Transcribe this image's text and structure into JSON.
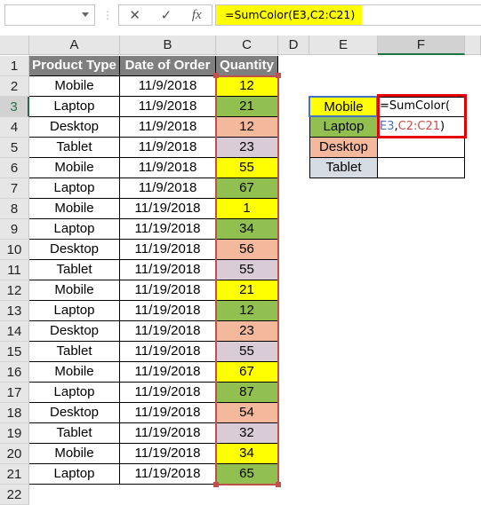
{
  "formula_bar": {
    "name_box": "",
    "formula": "=SumColor(E3,C2:C21)",
    "cancel_icon": "✕",
    "enter_icon": "✓",
    "fx_label": "fx"
  },
  "columns": [
    "A",
    "B",
    "C",
    "D",
    "E",
    "F"
  ],
  "rows": [
    "1",
    "2",
    "3",
    "4",
    "5",
    "6",
    "7",
    "8",
    "9",
    "10",
    "11",
    "12",
    "13",
    "14",
    "15",
    "16",
    "17",
    "18",
    "19",
    "20",
    "21",
    "22"
  ],
  "table": {
    "headers": [
      "Product Type",
      "Date of Order",
      "Quantity"
    ],
    "rows": [
      {
        "type": "Mobile",
        "date": "11/9/2018",
        "qty": "12",
        "color": "#ffff00"
      },
      {
        "type": "Laptop",
        "date": "11/9/2018",
        "qty": "21",
        "color": "#92c050"
      },
      {
        "type": "Desktop",
        "date": "11/9/2018",
        "qty": "12",
        "color": "#f4b89c"
      },
      {
        "type": "Tablet",
        "date": "11/9/2018",
        "qty": "23",
        "color": "#d9ccd7"
      },
      {
        "type": "Mobile",
        "date": "11/9/2018",
        "qty": "55",
        "color": "#ffff00"
      },
      {
        "type": "Laptop",
        "date": "11/9/2018",
        "qty": "67",
        "color": "#92c050"
      },
      {
        "type": "Mobile",
        "date": "11/19/2018",
        "qty": "1",
        "color": "#ffff00"
      },
      {
        "type": "Laptop",
        "date": "11/19/2018",
        "qty": "34",
        "color": "#92c050"
      },
      {
        "type": "Desktop",
        "date": "11/19/2018",
        "qty": "56",
        "color": "#f4b89c"
      },
      {
        "type": "Tablet",
        "date": "11/19/2018",
        "qty": "55",
        "color": "#d9ccd7"
      },
      {
        "type": "Mobile",
        "date": "11/19/2018",
        "qty": "21",
        "color": "#ffff00"
      },
      {
        "type": "Laptop",
        "date": "11/19/2018",
        "qty": "12",
        "color": "#92c050"
      },
      {
        "type": "Desktop",
        "date": "11/19/2018",
        "qty": "23",
        "color": "#f4b89c"
      },
      {
        "type": "Tablet",
        "date": "11/19/2018",
        "qty": "55",
        "color": "#d9ccd7"
      },
      {
        "type": "Mobile",
        "date": "11/19/2018",
        "qty": "67",
        "color": "#ffff00"
      },
      {
        "type": "Laptop",
        "date": "11/19/2018",
        "qty": "87",
        "color": "#92c050"
      },
      {
        "type": "Desktop",
        "date": "11/19/2018",
        "qty": "54",
        "color": "#f4b89c"
      },
      {
        "type": "Tablet",
        "date": "11/19/2018",
        "qty": "32",
        "color": "#d9ccd7"
      },
      {
        "type": "Mobile",
        "date": "11/19/2018",
        "qty": "34",
        "color": "#ffff00"
      },
      {
        "type": "Laptop",
        "date": "11/19/2018",
        "qty": "65",
        "color": "#92c050"
      }
    ]
  },
  "summary": {
    "labels": [
      {
        "text": "Mobile",
        "color": "#ffff00"
      },
      {
        "text": "Laptop",
        "color": "#92c050"
      },
      {
        "text": "Desktop",
        "color": "#f4b89c"
      },
      {
        "text": "Tablet",
        "color": "#d6dce4"
      }
    ],
    "formula_line1": "=SumColor(",
    "formula_arg1": "E3",
    "formula_sep": ",",
    "formula_arg2": "C2:C21",
    "formula_end": ")"
  }
}
